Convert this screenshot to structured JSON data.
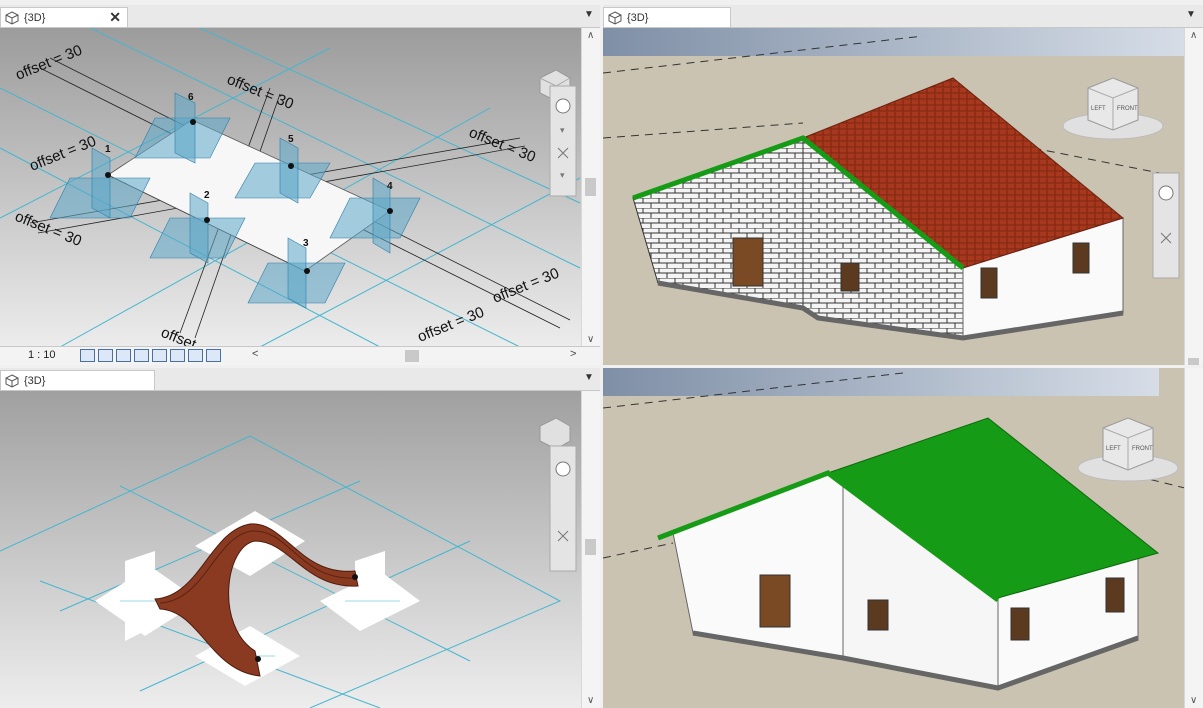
{
  "views": {
    "top_left": {
      "tab_title": "{3D}",
      "close_glyph": "✕",
      "scale": "1 : 10"
    },
    "top_right": {
      "tab_title": "{3D}"
    },
    "bottom_left": {
      "tab_title": "{3D}"
    },
    "bottom_right": {}
  },
  "annotations": {
    "offset_labels": [
      "offset = 30",
      "offset = 30",
      "offset = 30",
      "offset = 30",
      "offset = 30",
      "offset = 30",
      "offset = 30",
      "offset"
    ],
    "point_numbers": [
      "1",
      "2",
      "3",
      "4",
      "5",
      "6"
    ]
  },
  "viewcube": {
    "left_label": "LEFT",
    "front_label": "FRONT"
  },
  "colors": {
    "roof_tile": "#a8381d",
    "roof_green": "#159b15",
    "ref_plane": "#5da7c9",
    "grid_cyan": "#3fb3cc"
  },
  "icons": [
    "viewcube-icon",
    "steering-wheel-icon",
    "zoom-icon",
    "scale-icon",
    "detail-level-icon",
    "visual-style-icon",
    "sun-path-icon",
    "shadows-icon",
    "render-icon",
    "crop-icon",
    "hide-icon",
    "temp-hide-icon",
    "reveal-icon"
  ]
}
